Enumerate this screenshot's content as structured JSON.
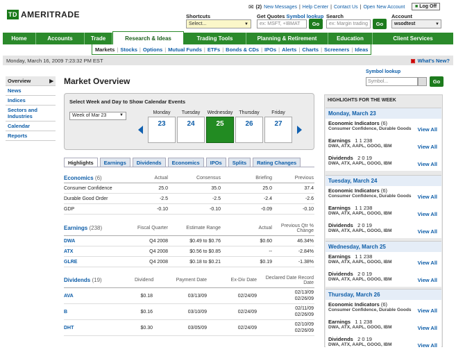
{
  "brand": {
    "td": "TD",
    "name": "AMERITRADE"
  },
  "toplinks": {
    "messages": "(2)",
    "new_messages": "New Messages",
    "help": "Help Center",
    "contact": "Contact Us",
    "open_account": "Open New Account",
    "log_off": "Log Off"
  },
  "shortcuts": {
    "label": "Shortcuts",
    "value": "Select..."
  },
  "quotes": {
    "label": "Get Quotes",
    "symbol_lookup": "Symbol lookup",
    "placeholder": "ex: MSFT, +IBMAT",
    "go": "Go"
  },
  "search": {
    "label": "Search",
    "placeholder": "ex: Margin trading",
    "go": "Go"
  },
  "account": {
    "label": "Account",
    "value": "wsodtest"
  },
  "nav": [
    "Home",
    "Accounts",
    "Trade",
    "Research & Ideas",
    "Trading Tools",
    "Planning & Retirement",
    "Education",
    "Client Services"
  ],
  "subnav": [
    "Markets",
    "Stocks",
    "Options",
    "Mutual Funds",
    "ETFs",
    "Bonds & CDs",
    "IPOs",
    "Alerts",
    "Charts",
    "Screeners",
    "Ideas"
  ],
  "datebar": {
    "date": "Monday, March 16, 2009 7:23:32 PM EST",
    "whats_new": "What's New?"
  },
  "sidebar": [
    "Overview",
    "News",
    "Indices",
    "Sectors and Industries",
    "Calendar",
    "Reports"
  ],
  "main": {
    "title": "Market Overview",
    "cal_head": "Select Week and Day to Show Calendar Events",
    "week": "Week of Mar 23"
  },
  "days": [
    {
      "name": "Monday",
      "num": "23"
    },
    {
      "name": "Tuesday",
      "num": "24"
    },
    {
      "name": "Wednesday",
      "num": "25"
    },
    {
      "name": "Thursday",
      "num": "26"
    },
    {
      "name": "Friday",
      "num": "27"
    }
  ],
  "tabs": [
    "Highlights",
    "Earnings",
    "Dividends",
    "Economics",
    "IPOs",
    "Splits",
    "Rating Changes"
  ],
  "economics": {
    "title": "Economics",
    "count": "(6)",
    "headers": [
      "Actual",
      "Consensus",
      "Briefing",
      "Previous"
    ],
    "rows": [
      [
        "Consumer Confidence",
        "25.0",
        "35.0",
        "25.0",
        "37.4"
      ],
      [
        "Durable Good Order",
        "-2.5",
        "-2.5",
        "-2.4",
        "-2.6"
      ],
      [
        "GDP",
        "-0.10",
        "-0.10",
        "-0.09",
        "-0.10"
      ]
    ]
  },
  "earnings": {
    "title": "Earnings",
    "count": "(238)",
    "headers": [
      "Fiscal Quarter",
      "Estimate Range",
      "Actual",
      "Previous Qtr % Change"
    ],
    "rows": [
      [
        "DWA",
        "Q4 2008",
        "$0.49 to $0.76",
        "$0.60",
        "46.34%"
      ],
      [
        "ATX",
        "Q4 2008",
        "$0.56 to $0.85",
        "--",
        "-2.84%"
      ],
      [
        "GLRE",
        "Q4 2008",
        "$0.18 to $0.21",
        "$0.19",
        "-1.38%"
      ]
    ]
  },
  "dividends": {
    "title": "Dividends",
    "count": "(19)",
    "headers": [
      "Dividend",
      "Payment Date",
      "Ex-Div Date",
      "Declared Date Record Date"
    ],
    "rows": [
      [
        "AVA",
        "$0.18",
        "03/13/09",
        "02/24/09",
        "02/13/09",
        "02/26/09"
      ],
      [
        "B",
        "$0.16",
        "03/10/09",
        "02/24/09",
        "02/11/09",
        "02/26/09"
      ],
      [
        "DHT",
        "$0.30",
        "03/05/09",
        "02/24/09",
        "02/10/09",
        "02/26/09"
      ]
    ]
  },
  "symbol_lookup": {
    "label": "Symbol lookup",
    "placeholder": "Symbol...",
    "go": "Go"
  },
  "highlights": {
    "title": "HIGHLIGHTS FOR THE WEEK",
    "view_all": "View All",
    "days": [
      {
        "date": "Monday, March 23",
        "econ": "Economic Indicators",
        "econ_count": "(6)",
        "econ_sub": "Consumer Confidence, Durable Goods",
        "earn": "Earnings",
        "earn_nums": "1  1  238",
        "earn_sub": "DWA, ATX, AAPL, GOOG, IBM",
        "div": "Dividends",
        "div_nums": "2  0  19",
        "div_sub": "DWA, ATX, AAPL, GOOG, IBM"
      },
      {
        "date": "Tuesday, March 24",
        "econ": "Economic Indicators",
        "econ_count": "(6)",
        "econ_sub": "Consumer Confidence, Durable Goods",
        "earn": "Earnings",
        "earn_nums": "1  1  238",
        "earn_sub": "DWA, ATX, AAPL, GOOG, IBM",
        "div": "Dividends",
        "div_nums": "2  0  19",
        "div_sub": "DWA, ATX, AAPL, GOOG, IBM"
      },
      {
        "date": "Wednesday, March 25",
        "econ": "",
        "econ_count": "",
        "econ_sub": "",
        "earn": "Earnings",
        "earn_nums": "1  1  238",
        "earn_sub": "DWA, ATX, AAPL, GOOG, IBM",
        "div": "Dividends",
        "div_nums": "2  0  19",
        "div_sub": "DWA, ATX, AAPL, GOOG, IBM"
      },
      {
        "date": "Thursday, March 26",
        "econ": "Economic Indicators",
        "econ_count": "(6)",
        "econ_sub": "Consumer Confidence, Durable Goods",
        "earn": "Earnings",
        "earn_nums": "1  1  238",
        "earn_sub": "DWA, ATX, AAPL, GOOG, IBM",
        "div": "Dividends",
        "div_nums": "2  0  19",
        "div_sub": "DWA, ATX, AAPL, GOOG, IBM"
      }
    ]
  }
}
